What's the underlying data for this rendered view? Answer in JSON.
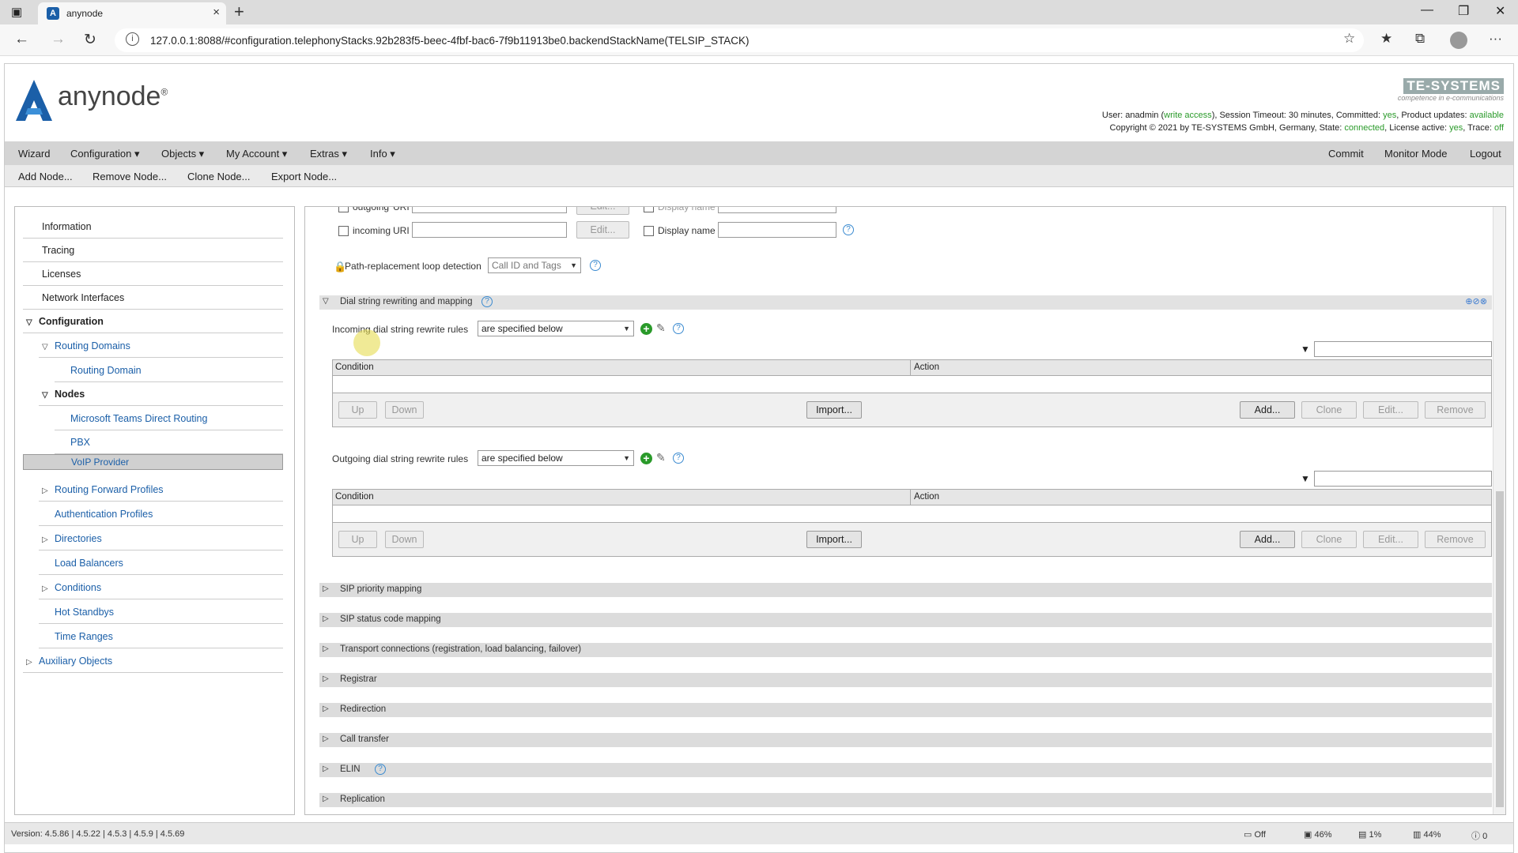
{
  "browser": {
    "tab_title": "anynode",
    "url": "127.0.0.1:8088/#configuration.telephonyStacks.92b283f5-beec-4fbf-bac6-7f9b11913be0.backendStackName(TELSIP_STACK)"
  },
  "header": {
    "brand": "anynode",
    "company_logo": "TE-SYSTEMS",
    "company_tag": "competence in e-communications",
    "user_line_parts": [
      "User: anadmin (",
      "write access",
      "), Session Timeout: 30 minutes, Committed: ",
      "yes",
      ", Product updates: ",
      "available"
    ],
    "copyright_parts": [
      "Copyright © 2021 by TE-SYSTEMS GmbH, Germany, State: ",
      "connected",
      ", License active: ",
      "yes",
      ", Trace: ",
      "off"
    ]
  },
  "menu": {
    "items": [
      "Wizard",
      "Configuration ▾",
      "Objects ▾",
      "My Account ▾",
      "Extras ▾",
      "Info ▾"
    ],
    "right": [
      "Commit",
      "Monitor Mode",
      "Logout"
    ]
  },
  "nodebar": {
    "items": [
      "Add Node...",
      "Remove Node...",
      "Clone Node...",
      "Export Node..."
    ]
  },
  "sidebar": {
    "items": [
      {
        "label": "Information"
      },
      {
        "label": "Tracing"
      },
      {
        "label": "Licenses"
      },
      {
        "label": "Network Interfaces"
      },
      {
        "label": "Configuration"
      },
      {
        "label": "Routing Domains"
      },
      {
        "label": "Routing Domain"
      },
      {
        "label": "Nodes"
      },
      {
        "label": "Microsoft Teams Direct Routing"
      },
      {
        "label": "PBX"
      },
      {
        "label": "VoIP Provider"
      },
      {
        "label": "Routing Forward Profiles"
      },
      {
        "label": "Authentication Profiles"
      },
      {
        "label": "Directories"
      },
      {
        "label": "Load Balancers"
      },
      {
        "label": "Conditions"
      },
      {
        "label": "Hot Standbys"
      },
      {
        "label": "Time Ranges"
      },
      {
        "label": "Auxiliary Objects"
      }
    ]
  },
  "main": {
    "top_rows": [
      {
        "label": "outgoing",
        "uri": "URI",
        "edit": "Edit...",
        "display": "Display name"
      },
      {
        "label": "incoming",
        "uri": "URI",
        "edit": "Edit...",
        "display": "Display name"
      }
    ],
    "loop_label": "Path-replacement loop detection",
    "loop_value": "Call ID and Tags",
    "dial_section": "Dial string rewriting and mapping",
    "incoming_label": "Incoming dial string rewrite rules",
    "outgoing_label": "Outgoing dial string rewrite rules",
    "rules_value": "are specified below",
    "col_condition": "Condition",
    "col_action": "Action",
    "btn_up": "Up",
    "btn_down": "Down",
    "btn_import": "Import...",
    "btn_add": "Add...",
    "btn_clone": "Clone",
    "btn_edit": "Edit...",
    "btn_remove": "Remove",
    "sections": [
      "SIP priority mapping",
      "SIP status code mapping",
      "Transport connections (registration, load balancing, failover)",
      "Registrar",
      "Redirection",
      "Call transfer",
      "ELIN",
      "Replication"
    ]
  },
  "status": {
    "version": "Version: 4.5.86 | 4.5.22 | 4.5.3 | 4.5.9 | 4.5.69",
    "items": [
      "Off",
      "46%",
      "1%",
      "44%",
      "0"
    ]
  }
}
